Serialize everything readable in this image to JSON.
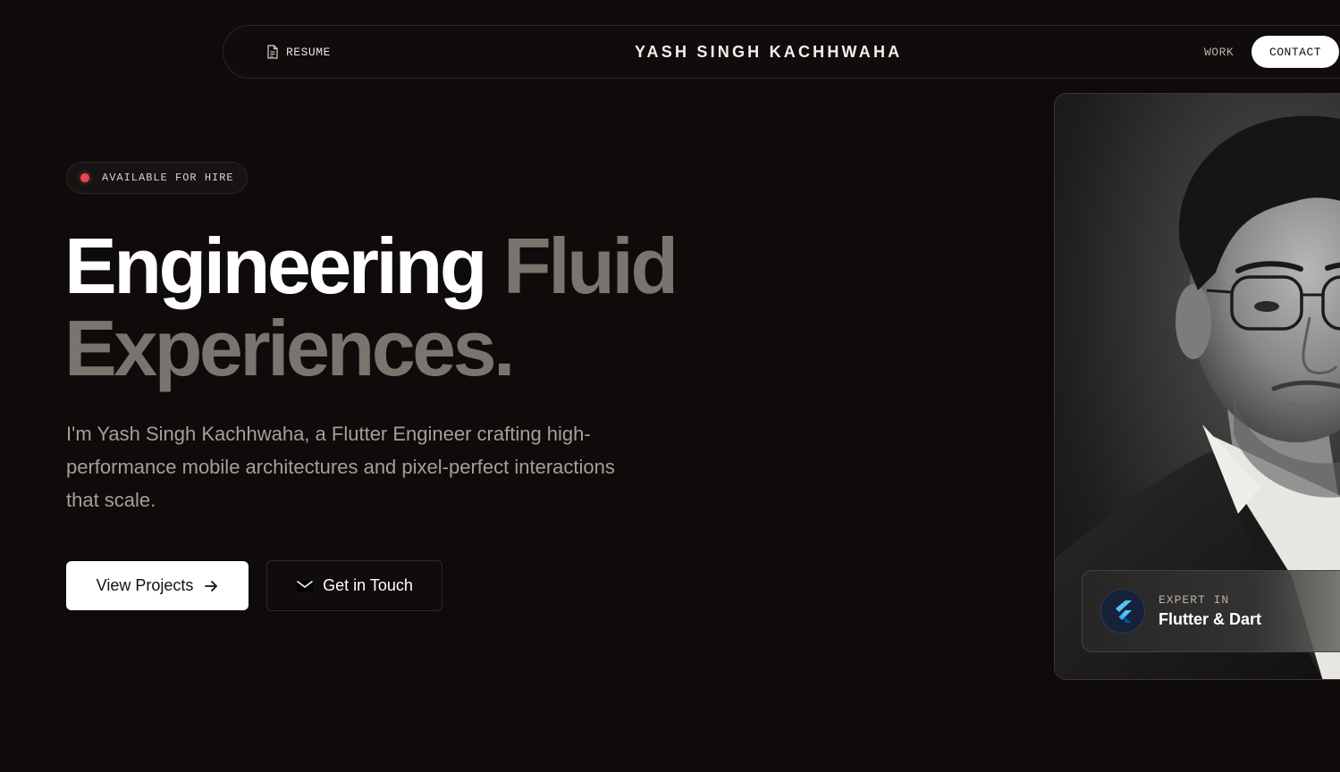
{
  "nav": {
    "resume_label": "RESUME",
    "title": "YASH SINGH KACHHWAHA",
    "work_label": "WORK",
    "contact_label": "CONTACT"
  },
  "hero": {
    "badge_text": "AVAILABLE FOR HIRE",
    "headline_word1": "Engineering",
    "headline_word2": "Fluid",
    "headline_line2": "Experiences.",
    "intro": "I'm Yash Singh Kachhwaha, a Flutter Engineer crafting high-performance mobile architectures and pixel-perfect interactions that scale.",
    "primary_button": "View Projects",
    "secondary_button": "Get in Touch"
  },
  "expert": {
    "label": "EXPERT IN",
    "value": "Flutter & Dart"
  },
  "colors": {
    "background": "#0e0b0a",
    "muted_headline": "#7b736d",
    "badge_dot": "#e5484d",
    "flutter_blue": "#54c5f8"
  },
  "icons": {
    "resume": "document-icon",
    "primary_button": "arrow-right-icon",
    "secondary_button": "mail-icon",
    "expert": "flutter-logo-icon"
  }
}
